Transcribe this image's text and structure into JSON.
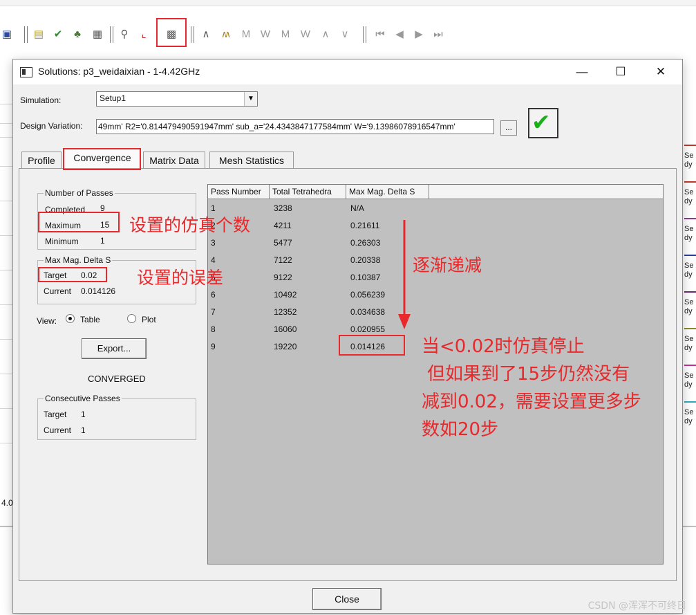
{
  "toolbar": {
    "icons": [
      "data-icon",
      "report-icon",
      "check-icon",
      "model-icon",
      "list-icon",
      "search-plot-icon",
      "plot-icon",
      "solutions-icon",
      "wave-icon-1",
      "wave-icon-2",
      "wave-icon-3",
      "wave-icon-4",
      "wave-icon-5",
      "wave-icon-6",
      "wave-icon-7",
      "wave-icon-8",
      "first-icon",
      "prev-icon",
      "next-icon",
      "last-icon"
    ]
  },
  "background": {
    "left_label": "4.0",
    "legend": [
      "Se\ndy",
      "Se\ndy",
      "Se\ndy",
      "Se\ndy",
      "Se\ndy",
      "Se\ndy",
      "Se\ndy",
      "Se\ndy"
    ],
    "legend_colors": [
      "#c0392b",
      "#c0392b",
      "#8e3a8e",
      "#2c3e9e",
      "#6b2c6b",
      "#8a8a2c",
      "#c0309a",
      "#2ca8c0"
    ]
  },
  "dialog": {
    "title": "Solutions: p3_weidaixian - 1-4.42GHz",
    "simulation_label": "Simulation:",
    "simulation_value": "Setup1",
    "design_variation_label": "Design Variation:",
    "design_variation_value": "49mm' R2='0.814479490591947mm' sub_a='24.4343847177584mm' W='9.13986078916547mm'",
    "ellipsis_button": "...",
    "tabs": [
      "Profile",
      "Convergence",
      "Matrix Data",
      "Mesh Statistics"
    ],
    "passes_group": {
      "title": "Number of Passes",
      "completed_label": "Completed",
      "completed_value": "9",
      "maximum_label": "Maximum",
      "maximum_value": "15",
      "minimum_label": "Minimum",
      "minimum_value": "1"
    },
    "delta_group": {
      "title": "Max Mag. Delta S",
      "target_label": "Target",
      "target_value": "0.02",
      "current_label": "Current",
      "current_value": "0.014126"
    },
    "view_label": "View:",
    "view_table": "Table",
    "view_plot": "Plot",
    "export_button": "Export...",
    "status": "CONVERGED",
    "consecutive_group": {
      "title": "Consecutive Passes",
      "target_label": "Target",
      "target_value": "1",
      "current_label": "Current",
      "current_value": "1"
    },
    "table": {
      "columns": [
        "Pass Number",
        "Total Tetrahedra",
        "Max Mag. Delta S"
      ],
      "rows": [
        [
          "1",
          "3238",
          "N/A"
        ],
        [
          "2",
          "4211",
          "0.21611"
        ],
        [
          "3",
          "5477",
          "0.26303"
        ],
        [
          "4",
          "7122",
          "0.20338"
        ],
        [
          "5",
          "9122",
          "0.10387"
        ],
        [
          "6",
          "10492",
          "0.056239"
        ],
        [
          "7",
          "12352",
          "0.034638"
        ],
        [
          "8",
          "16060",
          "0.020955"
        ],
        [
          "9",
          "19220",
          "0.014126"
        ]
      ]
    },
    "close_button": "Close"
  },
  "annotations": {
    "max_passes_note": "设置的仿真个数",
    "target_note": "设置的误差",
    "decreasing_note": "逐渐递减",
    "stop_note_1": "当<0.02时仿真停止",
    "stop_note_2": "但如果到了15步仍然没有",
    "stop_note_3": "减到0.02，需要设置更多步",
    "stop_note_4": "数如20步",
    "color": "#e8282b"
  },
  "watermark": "CSDN @浑浑不可终日"
}
